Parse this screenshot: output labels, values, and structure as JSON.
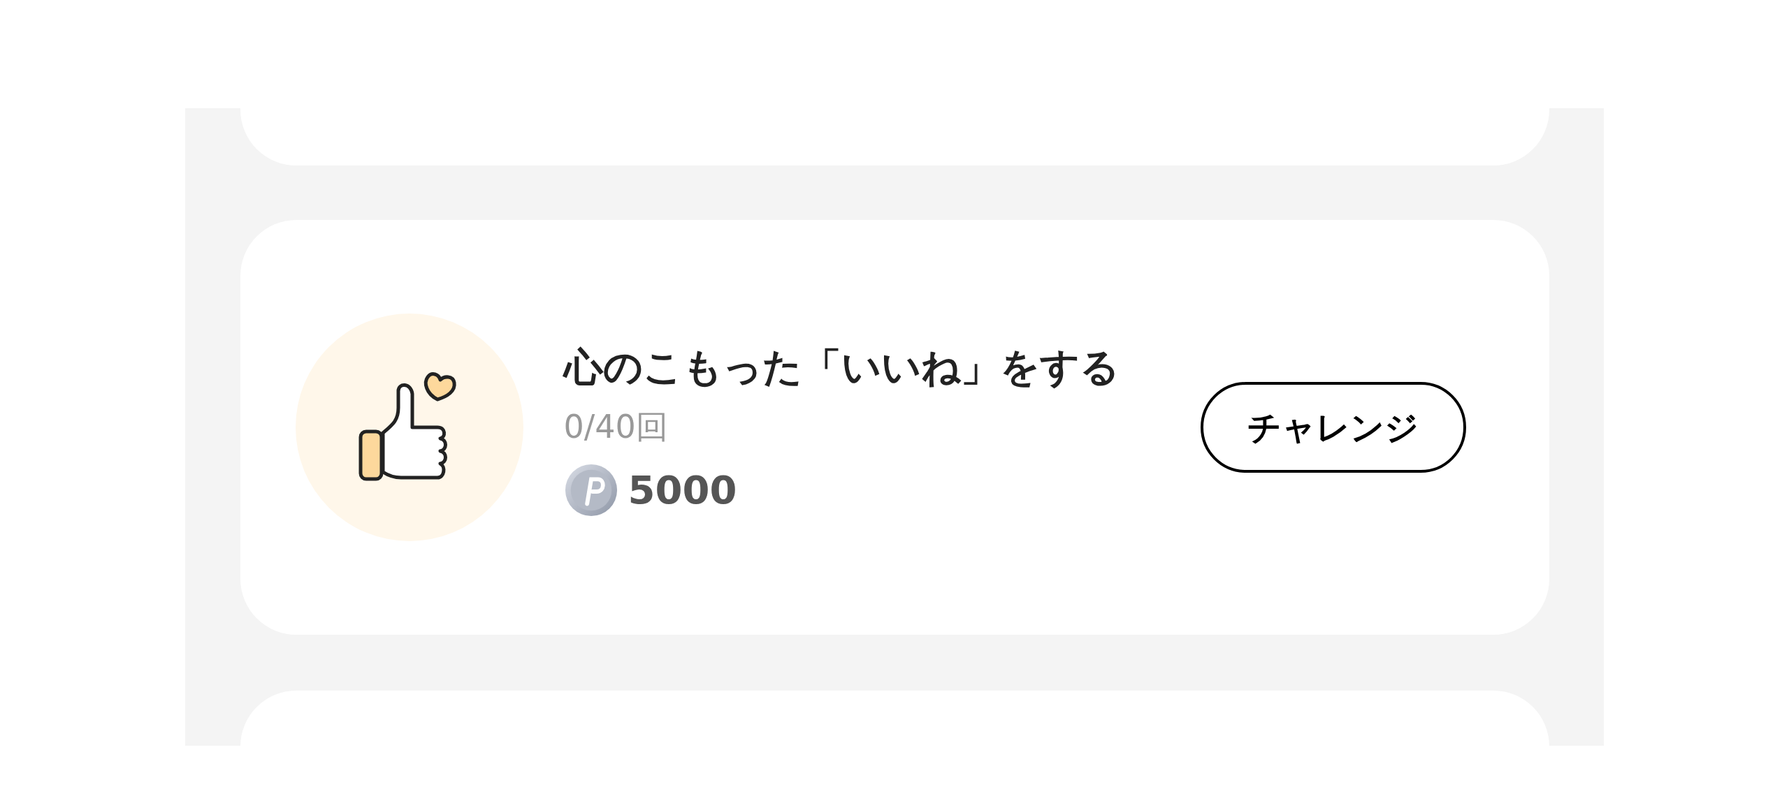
{
  "mission": {
    "title": "心のこもった「いいね」をする",
    "progress": "0/40回",
    "reward": "5000",
    "button": "チャレンジ"
  }
}
